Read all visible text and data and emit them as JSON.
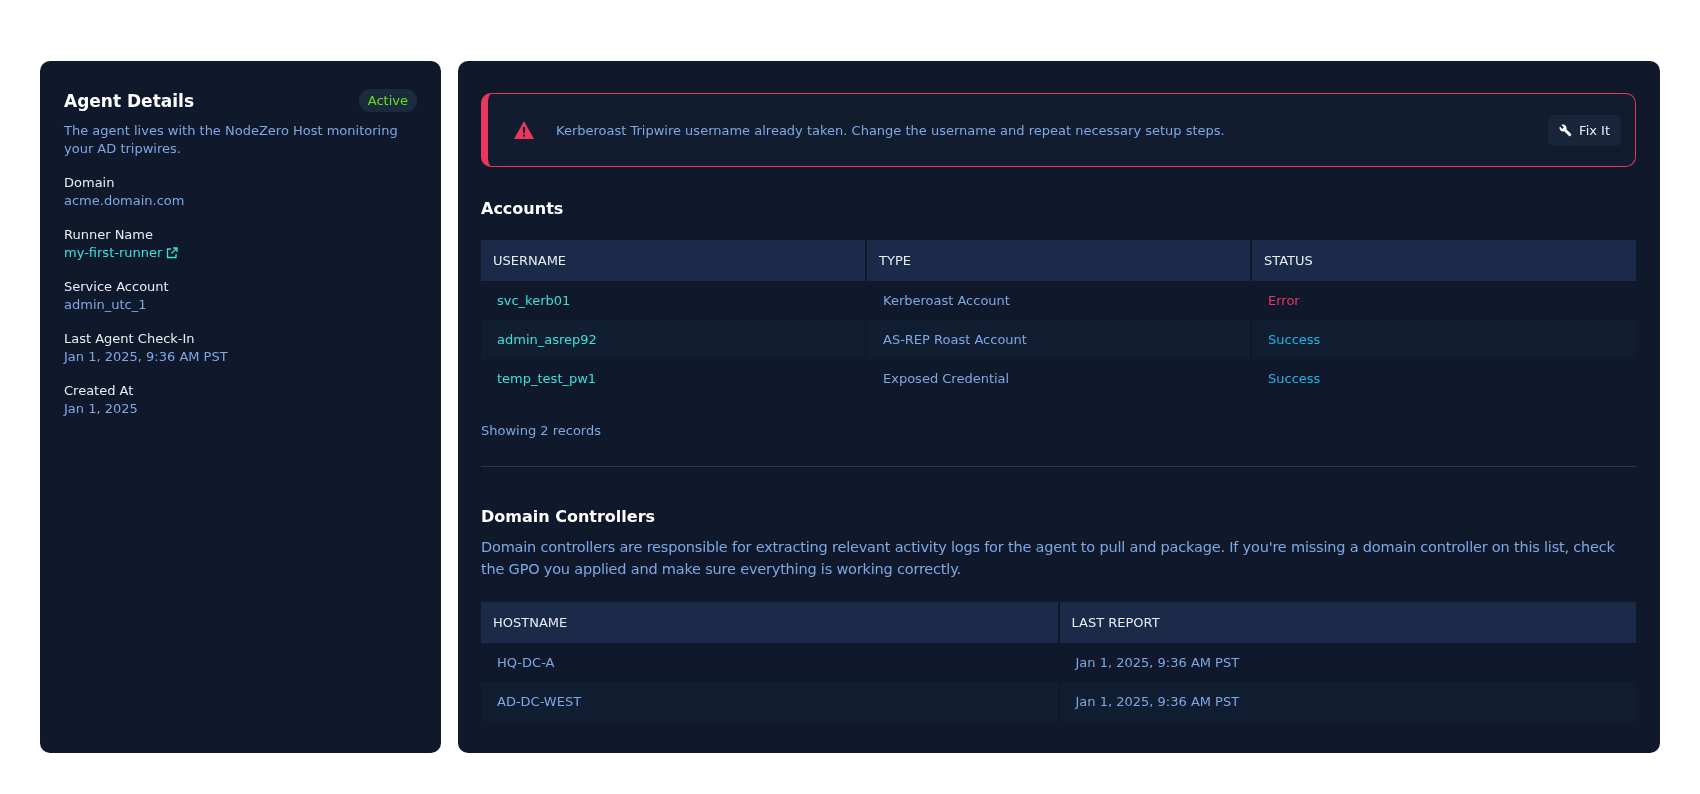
{
  "agent_details": {
    "title": "Agent Details",
    "status_badge": "Active",
    "description": "The agent lives with the NodeZero Host monitoring your AD tripwires.",
    "fields": [
      {
        "label": "Domain",
        "value": "acme.domain.com",
        "kind": "text"
      },
      {
        "label": "Runner Name",
        "value": "my-first-runner",
        "kind": "link"
      },
      {
        "label": "Service Account",
        "value": "admin_utc_1",
        "kind": "text"
      },
      {
        "label": "Last Agent Check-In",
        "value": "Jan 1, 2025, 9:36 AM PST",
        "kind": "text"
      },
      {
        "label": "Created At",
        "value": "Jan 1, 2025",
        "kind": "text"
      }
    ]
  },
  "alert": {
    "message": "Kerberoast Tripwire username already taken. Change the username and repeat necessary setup steps.",
    "button": "Fix It"
  },
  "accounts": {
    "title": "Accounts",
    "columns": [
      "USERNAME",
      "TYPE",
      "STATUS"
    ],
    "rows": [
      {
        "username": "svc_kerb01",
        "type": "Kerberoast Account",
        "status": "Error",
        "kind": "error"
      },
      {
        "username": "admin_asrep92",
        "type": "AS-REP Roast Account",
        "status": "Success",
        "kind": "success"
      },
      {
        "username": "temp_test_pw1",
        "type": "Exposed Credential",
        "status": "Success",
        "kind": "success"
      }
    ],
    "footer": "Showing 2 records"
  },
  "domain_controllers": {
    "title": "Domain Controllers",
    "description": "Domain controllers are responsible for extracting relevant activity logs for the agent to pull and package. If you're missing a domain controller on this list, check the GPO you applied and make sure everything is working correctly.",
    "columns": [
      "HOSTNAME",
      "LAST REPORT"
    ],
    "rows": [
      {
        "hostname": "HQ-DC-A",
        "last_report": "Jan 1, 2025, 9:36 AM PST"
      },
      {
        "hostname": "AD-DC-WEST",
        "last_report": "Jan 1, 2025, 9:36 AM PST"
      }
    ]
  }
}
